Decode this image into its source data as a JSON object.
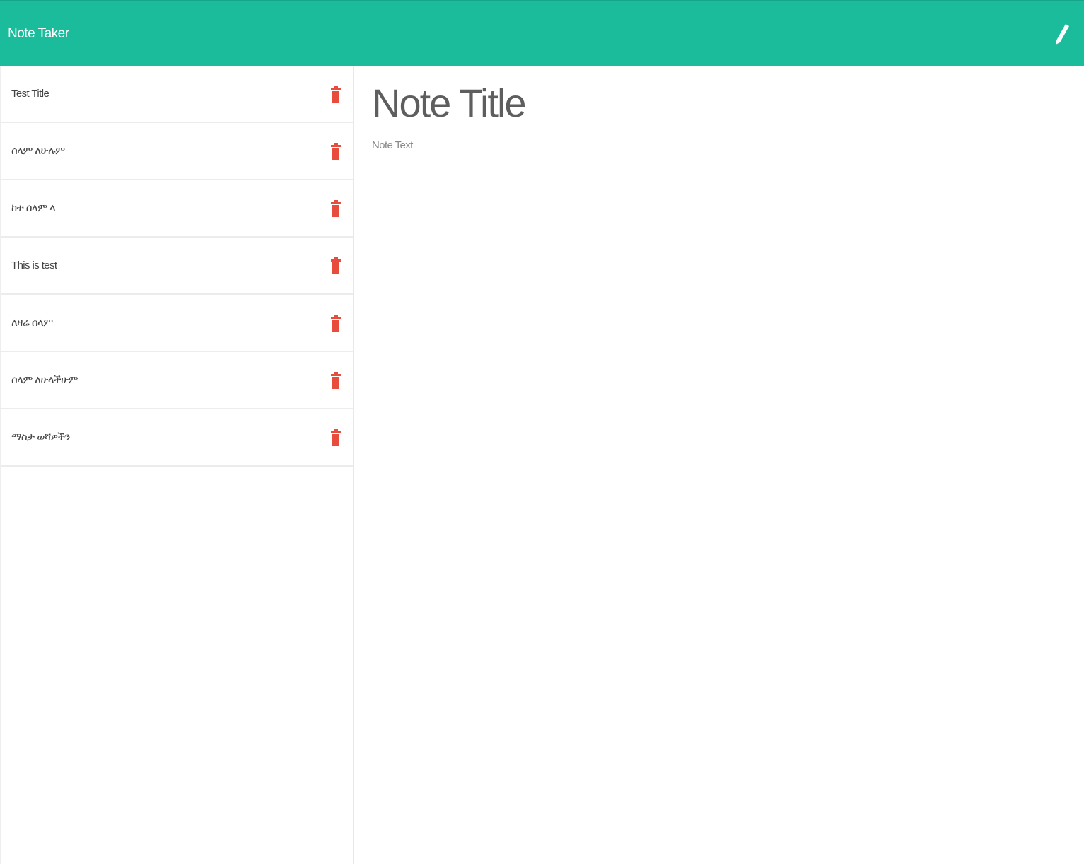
{
  "app": {
    "title": "Note Taker",
    "brand_color": "#1abc9c",
    "delete_color": "#e74c3c"
  },
  "header": {
    "new_note_icon": "pencil-icon"
  },
  "sidebar": {
    "delete_icon": "trash-icon",
    "notes": [
      {
        "title": "Test Title"
      },
      {
        "title": "ሰላም ለሁሉም"
      },
      {
        "title": "ከተ ሰላም ላ"
      },
      {
        "title": "This is test"
      },
      {
        "title": "ለዛሬ ሰላም"
      },
      {
        "title": "ሰላም ለሁላችሁም"
      },
      {
        "title": "ማስታ ወሻዎችን"
      }
    ]
  },
  "editor": {
    "title_placeholder": "Note Title",
    "text_placeholder": "Note Text"
  }
}
